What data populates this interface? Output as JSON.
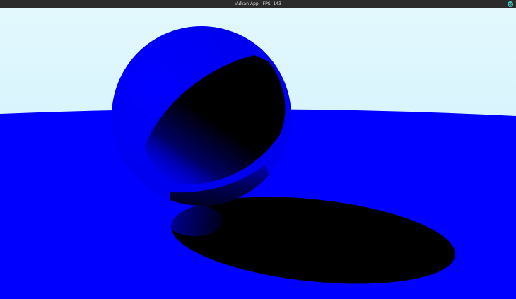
{
  "window": {
    "title": "Vulkan App - FPS: 143",
    "close_icon": "close-icon",
    "close_color": "#42c8c0",
    "titlebar_color": "#2b2b2b"
  },
  "scene": {
    "sky_top_color": "#e2f8fd",
    "sky_bottom_color": "#c9eefc",
    "ground_color": "#0000ff",
    "sphere_color": "#0000ff",
    "shadow_color": "#000000"
  }
}
